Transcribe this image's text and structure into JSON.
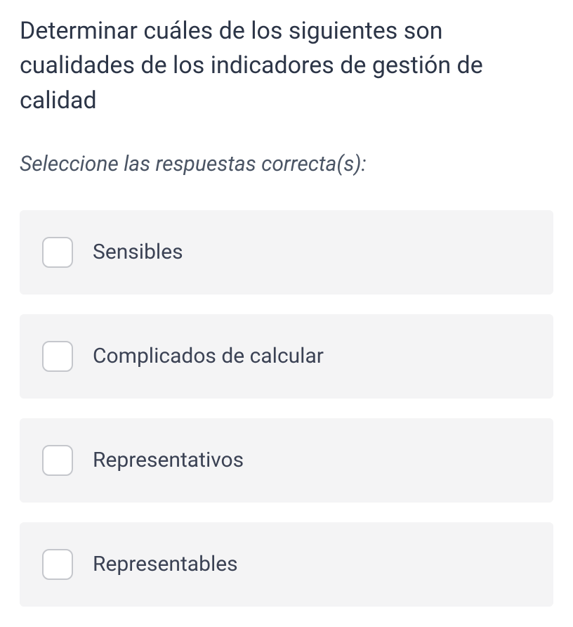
{
  "question": {
    "text": "Determinar cuáles de los siguientes son cualidades de los indicadores de gestión de calidad",
    "instruction": "Seleccione las respuestas correcta(s):"
  },
  "options": [
    {
      "label": "Sensibles"
    },
    {
      "label": "Complicados de calcular"
    },
    {
      "label": "Representativos"
    },
    {
      "label": "Representables"
    }
  ]
}
